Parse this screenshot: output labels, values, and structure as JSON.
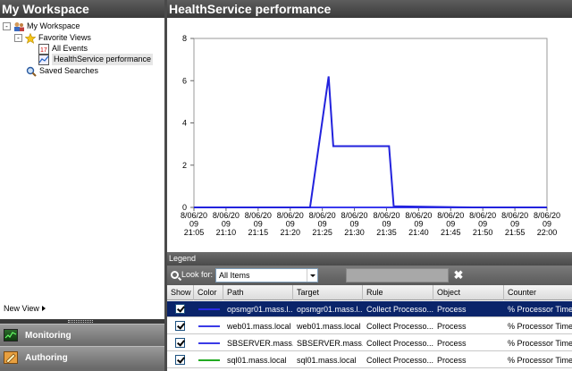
{
  "left_pane": {
    "title": "My Workspace",
    "tree": {
      "root": {
        "label": "My Workspace",
        "expander": "-"
      },
      "favorite_views": {
        "label": "Favorite Views",
        "expander": "-"
      },
      "all_events": {
        "label": "All Events"
      },
      "healthservice_performance": {
        "label": "HealthService performance"
      },
      "saved_searches": {
        "label": "Saved Searches"
      }
    },
    "new_view_label": "New View",
    "wunderbar": {
      "monitoring": "Monitoring",
      "authoring": "Authoring"
    }
  },
  "right_pane": {
    "title": "HealthService performance"
  },
  "chart_data": {
    "type": "line",
    "y_ticks": [
      "0",
      "2",
      "4",
      "6",
      "8"
    ],
    "ylim": [
      0,
      8
    ],
    "x_tick_labels": [
      [
        "8/06/20",
        "09",
        "21:05"
      ],
      [
        "8/06/20",
        "09",
        "21:10"
      ],
      [
        "8/06/20",
        "09",
        "21:15"
      ],
      [
        "8/06/20",
        "09",
        "21:20"
      ],
      [
        "8/06/20",
        "09",
        "21:25"
      ],
      [
        "8/06/20",
        "09",
        "21:30"
      ],
      [
        "8/06/20",
        "09",
        "21:35"
      ],
      [
        "8/06/20",
        "09",
        "21:40"
      ],
      [
        "8/06/20",
        "09",
        "21:45"
      ],
      [
        "8/06/20",
        "09",
        "21:50"
      ],
      [
        "8/06/20",
        "09",
        "21:55"
      ],
      [
        "8/06/20",
        "09",
        "22:00"
      ]
    ],
    "x_minutes_start": "21:05",
    "series": [
      {
        "color": "#2222dd",
        "points": [
          [
            0,
            0
          ],
          [
            25,
            0
          ],
          [
            29,
            6.2
          ],
          [
            30,
            2.9
          ],
          [
            42,
            2.9
          ],
          [
            43,
            0.05
          ],
          [
            60,
            0
          ],
          [
            76,
            0
          ]
        ]
      },
      {
        "color": "#3a3aee",
        "points": [
          [
            0,
            0
          ],
          [
            76,
            0
          ]
        ]
      },
      {
        "color": "#4a4aee",
        "points": [
          [
            0,
            0
          ],
          [
            76,
            0
          ]
        ]
      },
      {
        "color": "#22aa22",
        "points": [
          [
            0,
            0
          ],
          [
            76,
            0
          ]
        ]
      }
    ]
  },
  "legend": {
    "title": "Legend",
    "look_for_label": "Look for:",
    "look_for_value": "All Items",
    "clear_symbol": "✖",
    "columns": [
      "Show",
      "Color",
      "Path",
      "Target",
      "Rule",
      "Object",
      "Counter"
    ],
    "rows": [
      {
        "color": "#2a2ae6",
        "path": "opsmgr01.mass.l...",
        "target": "opsmgr01.mass.l...",
        "rule": "Collect Processo...",
        "object": "Process",
        "counter": "% Processor Time",
        "selected": true
      },
      {
        "color": "#3a3ae6",
        "path": "web01.mass.local",
        "target": "web01.mass.local",
        "rule": "Collect Processo...",
        "object": "Process",
        "counter": "% Processor Time",
        "selected": false
      },
      {
        "color": "#3a3ae6",
        "path": "SBSERVER.mass....",
        "target": "SBSERVER.mass....",
        "rule": "Collect Processo...",
        "object": "Process",
        "counter": "% Processor Time",
        "selected": false
      },
      {
        "color": "#22aa22",
        "path": "sql01.mass.local",
        "target": "sql01.mass.local",
        "rule": "Collect Processo...",
        "object": "Process",
        "counter": "% Processor Time",
        "selected": false
      }
    ]
  }
}
